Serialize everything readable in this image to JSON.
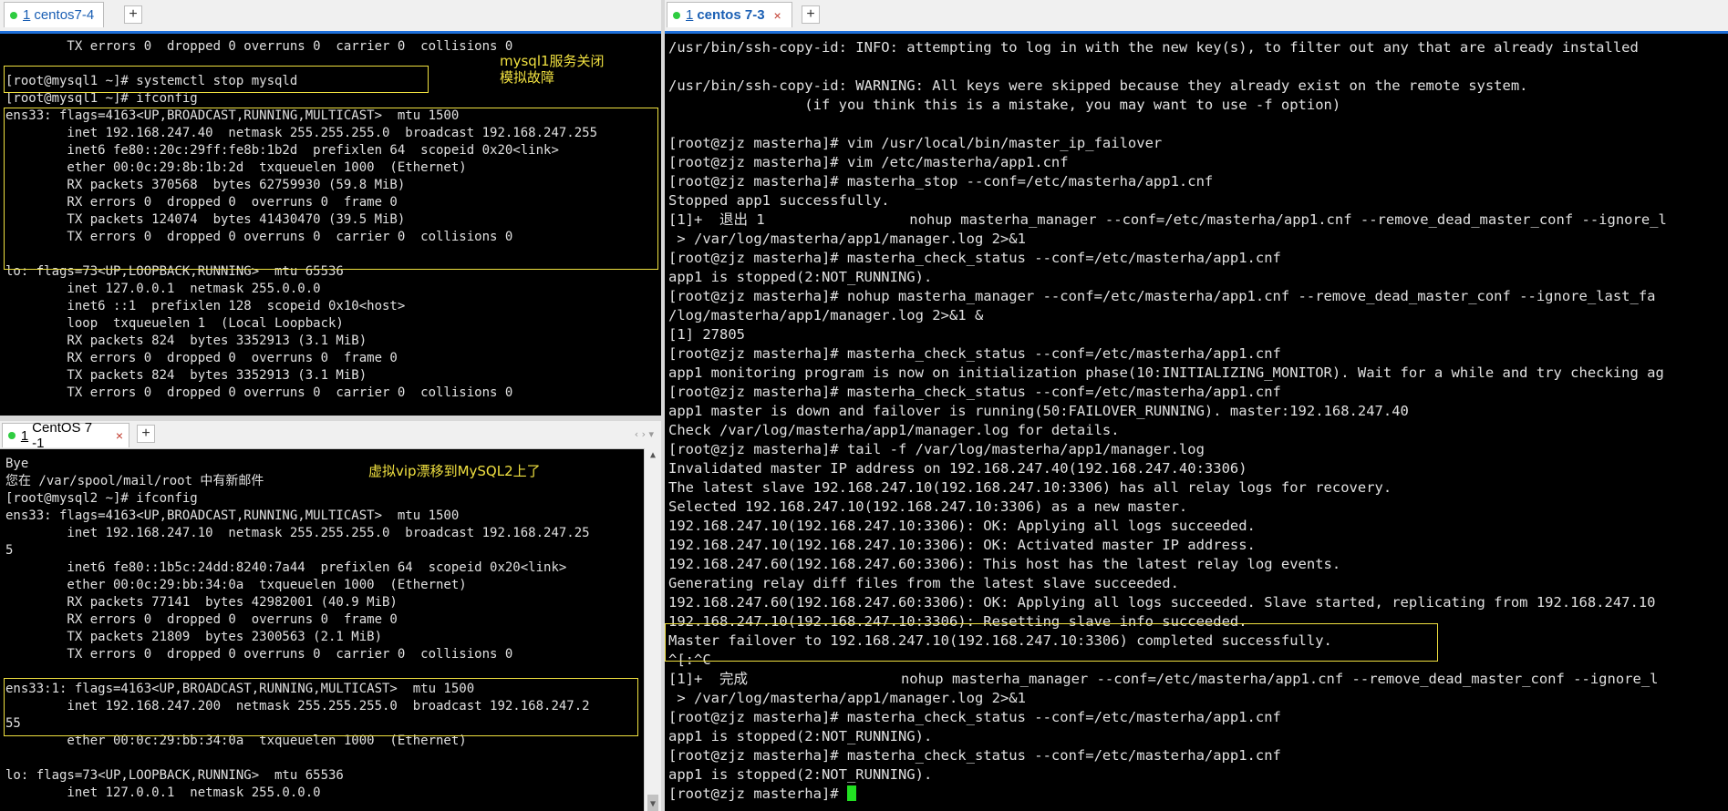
{
  "colors": {
    "accent": "#1e6fd9",
    "highlight": "#f0e040",
    "cursor": "#22e022",
    "terminal_bg": "#000000",
    "terminal_fg": "#e0e0e0"
  },
  "top_left": {
    "tab": {
      "number": "1",
      "title": "centos7-4"
    },
    "add_tab": "+",
    "lines": [
      "        TX errors 0  dropped 0 overruns 0  carrier 0  collisions 0",
      "",
      "[root@mysql1 ~]# systemctl stop mysqld",
      "[root@mysql1 ~]# ifconfig",
      "ens33: flags=4163<UP,BROADCAST,RUNNING,MULTICAST>  mtu 1500",
      "        inet 192.168.247.40  netmask 255.255.255.0  broadcast 192.168.247.255",
      "        inet6 fe80::20c:29ff:fe8b:1b2d  prefixlen 64  scopeid 0x20<link>",
      "        ether 00:0c:29:8b:1b:2d  txqueuelen 1000  (Ethernet)",
      "        RX packets 370568  bytes 62759930 (59.8 MiB)",
      "        RX errors 0  dropped 0  overruns 0  frame 0",
      "        TX packets 124074  bytes 41430470 (39.5 MiB)",
      "        TX errors 0  dropped 0 overruns 0  carrier 0  collisions 0",
      "",
      "lo: flags=73<UP,LOOPBACK,RUNNING>  mtu 65536",
      "        inet 127.0.0.1  netmask 255.0.0.0",
      "        inet6 ::1  prefixlen 128  scopeid 0x10<host>",
      "        loop  txqueuelen 1  (Local Loopback)",
      "        RX packets 824  bytes 3352913 (3.1 MiB)",
      "        RX errors 0  dropped 0  overruns 0  frame 0",
      "        TX packets 824  bytes 3352913 (3.1 MiB)",
      "        TX errors 0  dropped 0 overruns 0  carrier 0  collisions 0"
    ],
    "annotation": "mysql1服务关闭\n模拟故障"
  },
  "bottom_left": {
    "tab": {
      "number": "1",
      "title": "CentOS 7 -1"
    },
    "add_tab": "+",
    "nav": "‹ ›  ▾",
    "lines": [
      "Bye",
      "您在 /var/spool/mail/root 中有新邮件",
      "[root@mysql2 ~]# ifconfig",
      "ens33: flags=4163<UP,BROADCAST,RUNNING,MULTICAST>  mtu 1500",
      "        inet 192.168.247.10  netmask 255.255.255.0  broadcast 192.168.247.25",
      "5",
      "        inet6 fe80::1b5c:24dd:8240:7a44  prefixlen 64  scopeid 0x20<link>",
      "        ether 00:0c:29:bb:34:0a  txqueuelen 1000  (Ethernet)",
      "        RX packets 77141  bytes 42982001 (40.9 MiB)",
      "        RX errors 0  dropped 0  overruns 0  frame 0",
      "        TX packets 21809  bytes 2300563 (2.1 MiB)",
      "        TX errors 0  dropped 0 overruns 0  carrier 0  collisions 0",
      "",
      "ens33:1: flags=4163<UP,BROADCAST,RUNNING,MULTICAST>  mtu 1500",
      "        inet 192.168.247.200  netmask 255.255.255.0  broadcast 192.168.247.2",
      "55",
      "        ether 00:0c:29:bb:34:0a  txqueuelen 1000  (Ethernet)",
      "",
      "lo: flags=73<UP,LOOPBACK,RUNNING>  mtu 65536",
      "        inet 127.0.0.1  netmask 255.0.0.0"
    ],
    "annotation": "虚拟vip漂移到MySQL2上了"
  },
  "right": {
    "tab": {
      "number": "1",
      "title": "centos 7-3"
    },
    "add_tab": "+",
    "lines": [
      "/usr/bin/ssh-copy-id: INFO: attempting to log in with the new key(s), to filter out any that are already installed",
      "",
      "/usr/bin/ssh-copy-id: WARNING: All keys were skipped because they already exist on the remote system.",
      "                (if you think this is a mistake, you may want to use -f option)",
      "",
      "[root@zjz masterha]# vim /usr/local/bin/master_ip_failover",
      "[root@zjz masterha]# vim /etc/masterha/app1.cnf",
      "[root@zjz masterha]# masterha_stop --conf=/etc/masterha/app1.cnf",
      "Stopped app1 successfully.",
      "[1]+  退出 1                 nohup masterha_manager --conf=/etc/masterha/app1.cnf --remove_dead_master_conf --ignore_l",
      " > /var/log/masterha/app1/manager.log 2>&1",
      "[root@zjz masterha]# masterha_check_status --conf=/etc/masterha/app1.cnf",
      "app1 is stopped(2:NOT_RUNNING).",
      "[root@zjz masterha]# nohup masterha_manager --conf=/etc/masterha/app1.cnf --remove_dead_master_conf --ignore_last_fa",
      "/log/masterha/app1/manager.log 2>&1 &",
      "[1] 27805",
      "[root@zjz masterha]# masterha_check_status --conf=/etc/masterha/app1.cnf",
      "app1 monitoring program is now on initialization phase(10:INITIALIZING_MONITOR). Wait for a while and try checking ag",
      "[root@zjz masterha]# masterha_check_status --conf=/etc/masterha/app1.cnf",
      "app1 master is down and failover is running(50:FAILOVER_RUNNING). master:192.168.247.40",
      "Check /var/log/masterha/app1/manager.log for details.",
      "[root@zjz masterha]# tail -f /var/log/masterha/app1/manager.log",
      "Invalidated master IP address on 192.168.247.40(192.168.247.40:3306)",
      "The latest slave 192.168.247.10(192.168.247.10:3306) has all relay logs for recovery.",
      "Selected 192.168.247.10(192.168.247.10:3306) as a new master.",
      "192.168.247.10(192.168.247.10:3306): OK: Applying all logs succeeded.",
      "192.168.247.10(192.168.247.10:3306): OK: Activated master IP address.",
      "192.168.247.60(192.168.247.60:3306): This host has the latest relay log events.",
      "Generating relay diff files from the latest slave succeeded.",
      "192.168.247.60(192.168.247.60:3306): OK: Applying all logs succeeded. Slave started, replicating from 192.168.247.10",
      "192.168.247.10(192.168.247.10:3306): Resetting slave info succeeded.",
      "Master failover to 192.168.247.10(192.168.247.10:3306) completed successfully.",
      "^[:^C",
      "[1]+  完成                  nohup masterha_manager --conf=/etc/masterha/app1.cnf --remove_dead_master_conf --ignore_l",
      " > /var/log/masterha/app1/manager.log 2>&1",
      "[root@zjz masterha]# masterha_check_status --conf=/etc/masterha/app1.cnf",
      "app1 is stopped(2:NOT_RUNNING).",
      "[root@zjz masterha]# masterha_check_status --conf=/etc/masterha/app1.cnf",
      "app1 is stopped(2:NOT_RUNNING)."
    ],
    "prompt": "[root@zjz masterha]# "
  }
}
